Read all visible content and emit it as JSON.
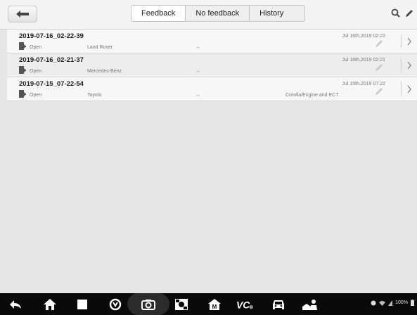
{
  "tabs": [
    {
      "label": "Feedback",
      "active": true
    },
    {
      "label": "No feedback",
      "active": false
    },
    {
      "label": "History",
      "active": false
    }
  ],
  "rows": [
    {
      "title": "2019-07-16_02-22-39",
      "status": "Open",
      "make": "Land Rover",
      "dash": "--",
      "system": "",
      "date": "Jul 16th,2019 02:22"
    },
    {
      "title": "2019-07-16_02-21-37",
      "status": "Open",
      "make": "Mercedes-Benz",
      "dash": "--",
      "system": "",
      "date": "Jul 16th,2019 02:21"
    },
    {
      "title": "2019-07-15_07-22-54",
      "status": "Open",
      "make": "Toyota",
      "dash": "--",
      "system": "Corolla/Engine and ECT",
      "date": "Jul 15th,2019 07:22"
    }
  ],
  "status_bar": {
    "battery": "100%"
  },
  "icons": {
    "back": "back-arrow-icon",
    "search": "search-icon",
    "edit": "pencil-icon",
    "row_doc": "document-icon",
    "row_edit": "pencil-icon",
    "row_chevron": "chevron-right-icon"
  },
  "colors": {
    "topbar": "#f4f4f4",
    "navbar": "#0a0a0a",
    "background": "#e6e6e6"
  }
}
